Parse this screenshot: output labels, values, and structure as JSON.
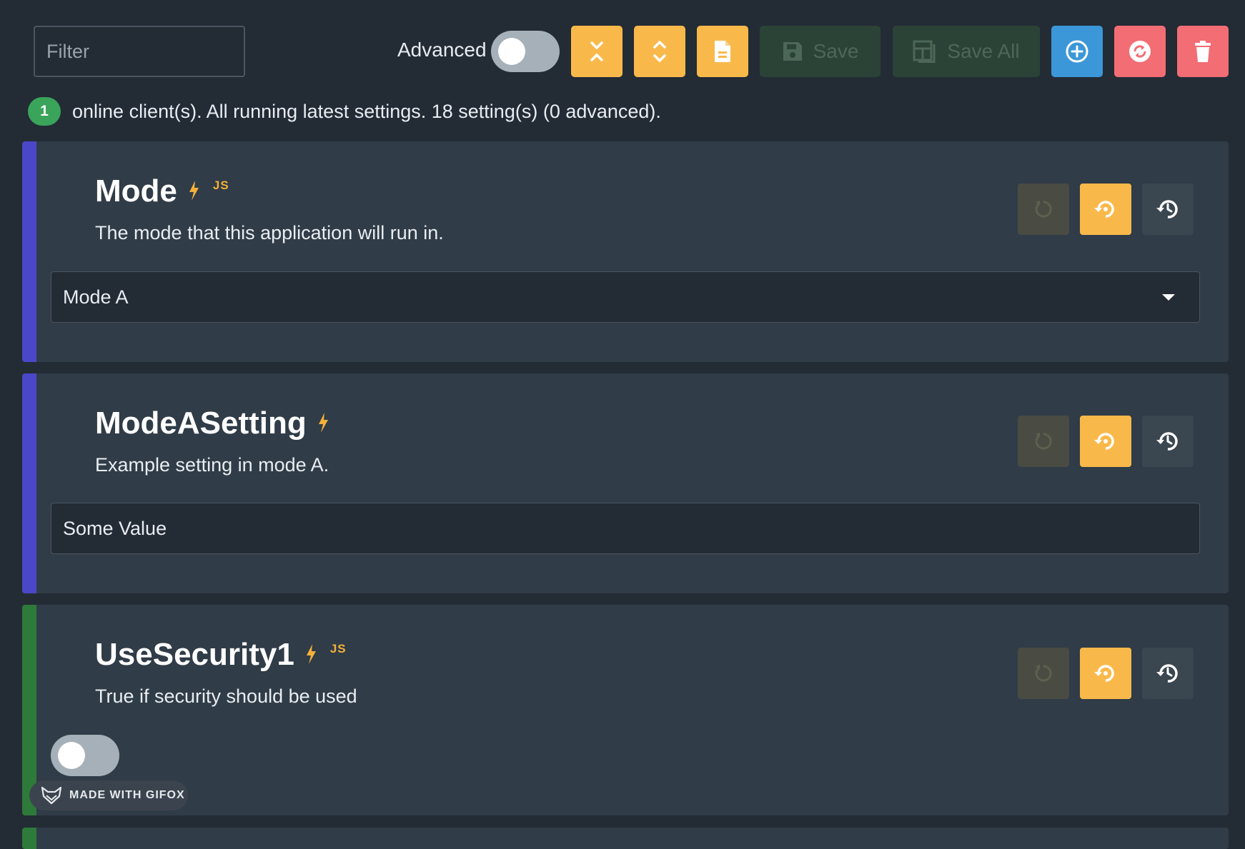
{
  "toolbar": {
    "filter_placeholder": "Filter",
    "advanced_label": "Advanced",
    "advanced_on": false,
    "save_label": "Save",
    "save_all_label": "Save All"
  },
  "status": {
    "client_count": "1",
    "message": "online client(s). All running latest settings. 18 setting(s) (0 advanced)."
  },
  "settings": [
    {
      "title": "Mode",
      "has_js": true,
      "js_label": "JS",
      "description": "The mode that this application will run in.",
      "value": "Mode A",
      "stripe_color": "#4a48c8"
    },
    {
      "title": "ModeASetting",
      "has_js": false,
      "description": "Example setting in mode A.",
      "value": "Some Value",
      "stripe_color": "#4a48c8"
    },
    {
      "title": "UseSecurity1",
      "has_js": true,
      "js_label": "JS",
      "description": "True if security should be used",
      "value": false,
      "stripe_color": "#2e7a3a"
    }
  ],
  "watermark": {
    "label": "MADE WITH GIFOX"
  },
  "colors": {
    "background": "#232b35",
    "card": "#303c47",
    "accent_yellow": "#f9b94a",
    "accent_blue": "#3b97d8",
    "accent_red": "#f26d74",
    "badge_green": "#3aa45a"
  }
}
